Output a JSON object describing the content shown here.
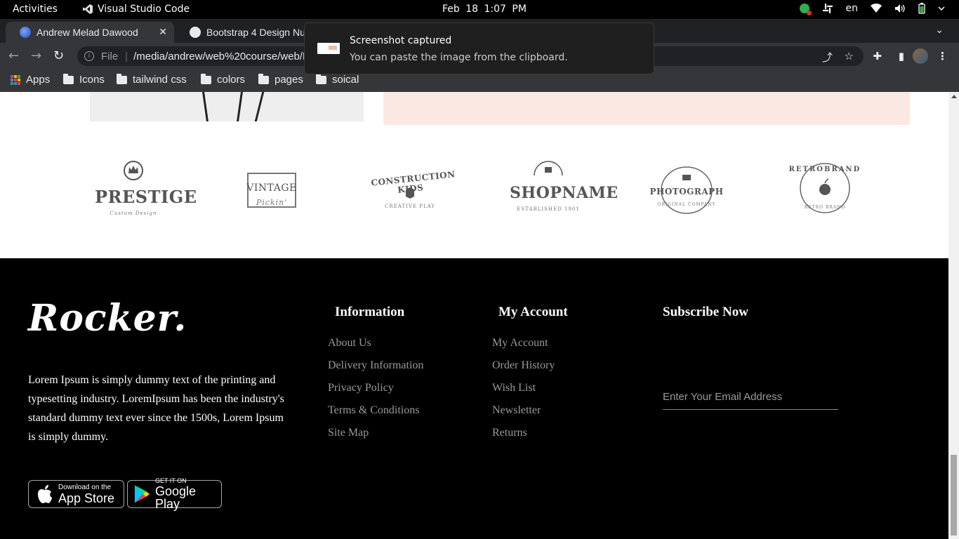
{
  "topbar": {
    "activities": "Activities",
    "app_name": "Visual Studio Code",
    "clock": "Feb 18  1:07 PM",
    "language": "en"
  },
  "browser": {
    "tabs": [
      {
        "title": "Andrew Melad Dawood",
        "active": true
      },
      {
        "title": "Bootstrap 4 Design Nu",
        "active": false
      }
    ],
    "omnibox": {
      "scheme": "File",
      "url": "/media/andrew/web%20course/web/Pr"
    },
    "bookmarks": [
      {
        "label": "Apps",
        "icon": "apps-grid-icon"
      },
      {
        "label": "Icons",
        "icon": "folder-icon"
      },
      {
        "label": "tailwind css",
        "icon": "folder-icon"
      },
      {
        "label": "colors",
        "icon": "folder-icon"
      },
      {
        "label": "pages",
        "icon": "folder-icon"
      },
      {
        "label": "soical",
        "icon": "folder-icon"
      }
    ]
  },
  "notification": {
    "title": "Screenshot captured",
    "body": "You can paste the image from the clipboard."
  },
  "brand_logos": [
    {
      "main": "PRESTIGE",
      "sub": "Custom Design"
    },
    {
      "main": "VINTAGE",
      "sub": "Pickin'"
    },
    {
      "main": "CONSTRUCTION KIDS",
      "sub": "CREATIVE PLAY"
    },
    {
      "main": "SHOPNAME",
      "sub": "ESTABLISHED 1901"
    },
    {
      "main": "PHOTOGRAPH",
      "sub": "ORIGINAL COMPANY"
    },
    {
      "main": "RETROBRAND",
      "sub": "RETRO BRAND"
    }
  ],
  "footer": {
    "brand": "Rocker.",
    "about": "Lorem Ipsum is simply dummy text of the printing and typesetting industry. LoremIpsum has been the industry's standard dummy text ever since the 1500s, Lorem Ipsum is simply dummy.",
    "information": {
      "title": "Information",
      "links": [
        "About Us",
        "Delivery Information",
        "Privacy Policy",
        "Terms & Conditions",
        "Site Map"
      ]
    },
    "account": {
      "title": "My Account",
      "links": [
        "My Account",
        "Order History",
        "Wish List",
        "Newsletter",
        "Returns"
      ]
    },
    "subscribe": {
      "title": "Subscribe Now",
      "placeholder": "Enter Your Email Address"
    },
    "app_store": {
      "line1": "Download on the",
      "line2": "App Store"
    },
    "google_play": {
      "line1": "GET IT ON",
      "line2": "Google Play"
    }
  },
  "colors": {
    "footer_bg": "#000000",
    "link_gray": "#9a9a9a",
    "pink_box": "#fce8e2"
  }
}
